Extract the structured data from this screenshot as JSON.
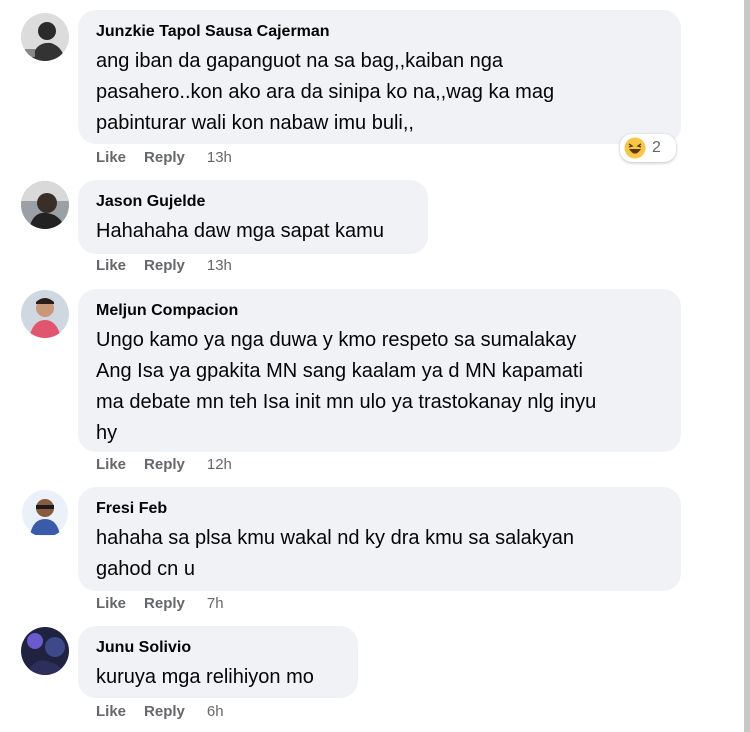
{
  "comments": [
    {
      "author": "Junzkie Tapol Sausa Cajerman",
      "lines": [
        "ang iban da gapanguot na sa bag,,kaiban nga",
        "pasahero..kon ako ara da sinipa ko na,,wag ka mag",
        "pabinturar wali kon nabaw imu buli,,"
      ],
      "like": "Like",
      "reply": "Reply",
      "time": "13h",
      "reaction": {
        "icon": "laughing-emoji-icon",
        "count": "2"
      }
    },
    {
      "author": "Jason Gujelde",
      "lines": [
        "Hahahaha daw mga sapat kamu"
      ],
      "like": "Like",
      "reply": "Reply",
      "time": "13h"
    },
    {
      "author": "Meljun Compacion",
      "lines": [
        "Ungo kamo ya nga duwa y kmo respeto sa sumalakay",
        "Ang Isa ya gpakita MN sang kaalam ya d MN kapamati",
        "ma debate mn teh Isa init mn ulo ya trastokanay nlg inyu",
        "hy"
      ],
      "like": "Like",
      "reply": "Reply",
      "time": "12h"
    },
    {
      "author": "Fresi Feb",
      "lines": [
        "hahaha sa plsa kmu wakal nd ky dra kmu sa salakyan",
        "gahod cn u"
      ],
      "like": "Like",
      "reply": "Reply",
      "time": "7h"
    },
    {
      "author": "Junu Solivio",
      "lines": [
        "kuruya mga relihiyon mo"
      ],
      "like": "Like",
      "reply": "Reply",
      "time": "6h"
    }
  ]
}
